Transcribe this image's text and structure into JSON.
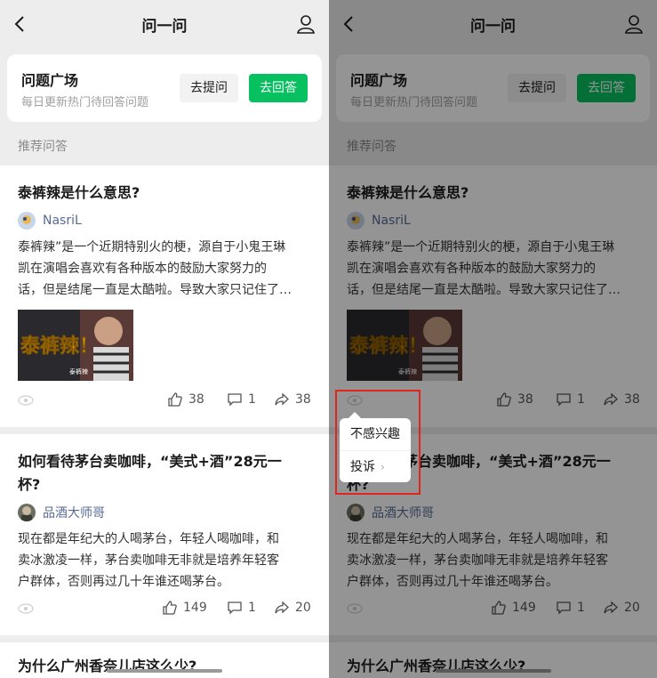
{
  "nav": {
    "title": "问一问"
  },
  "question_square": {
    "title": "问题广场",
    "subtitle": "每日更新热门待回答问题",
    "ask_button": "去提问",
    "answer_button": "去回答"
  },
  "section_label": "推荐问答",
  "posts": [
    {
      "title": "泰裤辣是什么意思?",
      "author": "NasriL",
      "excerpt_lines": [
        "泰裤辣”是一个近期特别火的梗，源自于小鬼王琳",
        "凯在演唱会喜欢有各种版本的鼓励大家努力的",
        "话，但是结尾一直是太酷啦。导致大家只记住了…"
      ],
      "thumb_text": "泰裤辣！",
      "thumb_caption": "泰裤辣",
      "likes": "38",
      "comments": "1",
      "shares": "38"
    },
    {
      "title_lines": [
        "如何看待茅台卖咖啡，“美式+酒”28元一",
        "杯?"
      ],
      "author": "品酒大师哥",
      "excerpt_lines": [
        "现在都是年纪大的人喝茅台，年轻人喝咖啡，和",
        "卖冰激凌一样，茅台卖咖啡无非就是培养年轻客",
        "户群体，否则再过几十年谁还喝茅台。"
      ],
      "likes": "149",
      "comments": "1",
      "shares": "20"
    },
    {
      "title": "为什么广州香奈儿店这么少?"
    }
  ],
  "popup": {
    "not_interested": "不感兴趣",
    "report": "投诉"
  },
  "colors": {
    "accent_green": "#07c160",
    "author_blue": "#576b95",
    "highlight_red": "#e0251f"
  }
}
